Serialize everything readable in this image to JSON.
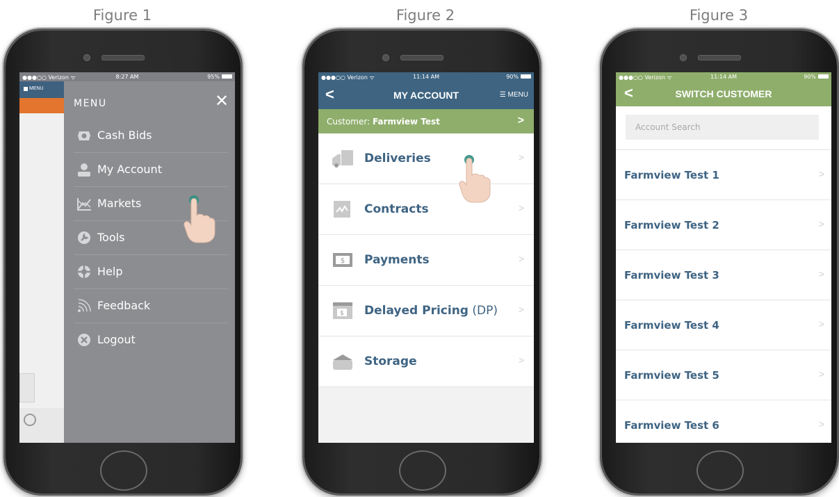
{
  "captions": [
    "Figure 1",
    "Figure 2",
    "Figure 3"
  ],
  "fig1": {
    "status": {
      "carrier": "●●●○○ Verizon ᯤ",
      "time": "8:27 AM",
      "battery": "95%"
    },
    "underlay": {
      "menu_label": "MENU"
    },
    "drawer": {
      "title": "MENU",
      "close": "✕",
      "items": [
        {
          "label": "Cash Bids",
          "icon": "cash-bids-icon"
        },
        {
          "label": "My Account",
          "icon": "account-icon"
        },
        {
          "label": "Markets",
          "icon": "markets-icon"
        },
        {
          "label": "Tools",
          "icon": "tools-icon"
        },
        {
          "label": "Help",
          "icon": "help-icon"
        },
        {
          "label": "Feedback",
          "icon": "feedback-icon"
        },
        {
          "label": "Logout",
          "icon": "logout-icon"
        }
      ]
    }
  },
  "fig2": {
    "status": {
      "carrier": "●●●○○ Verizon ᯤ",
      "time": "11:14 AM",
      "battery": "90%"
    },
    "nav": {
      "back": "<",
      "title": "MY ACCOUNT",
      "menu": "☰ MENU"
    },
    "customer": {
      "prefix": "Customer: ",
      "name": "Farmview Test",
      "chevron": ">"
    },
    "items": [
      {
        "label": "Deliveries",
        "suffix": "",
        "icon": "truck-icon"
      },
      {
        "label": "Contracts",
        "suffix": "",
        "icon": "contract-icon"
      },
      {
        "label": "Payments",
        "suffix": "",
        "icon": "payment-icon"
      },
      {
        "label": "Delayed Pricing",
        "suffix": " (DP)",
        "icon": "delayed-pricing-icon"
      },
      {
        "label": "Storage",
        "suffix": "",
        "icon": "storage-icon"
      }
    ],
    "chevron": ">"
  },
  "fig3": {
    "status": {
      "carrier": "●●●○○ Verizon ᯤ",
      "time": "11:14 AM",
      "battery": "90%"
    },
    "nav": {
      "back": "<",
      "title": "SWITCH CUSTOMER"
    },
    "search": {
      "placeholder": "Account Search"
    },
    "customers": [
      "Farmview Test 1",
      "Farmview Test 2",
      "Farmview Test 3",
      "Farmview Test 4",
      "Farmview Test 5",
      "Farmview Test 6"
    ],
    "chevron": ">"
  },
  "colors": {
    "nav_blue": "#3e6481",
    "nav_green": "#8fae6c",
    "label_blue": "#3f6483",
    "drawer_gray": "#8c8d90",
    "accent_orange": "#e3752f",
    "tap_dot": "#2f8f83"
  }
}
